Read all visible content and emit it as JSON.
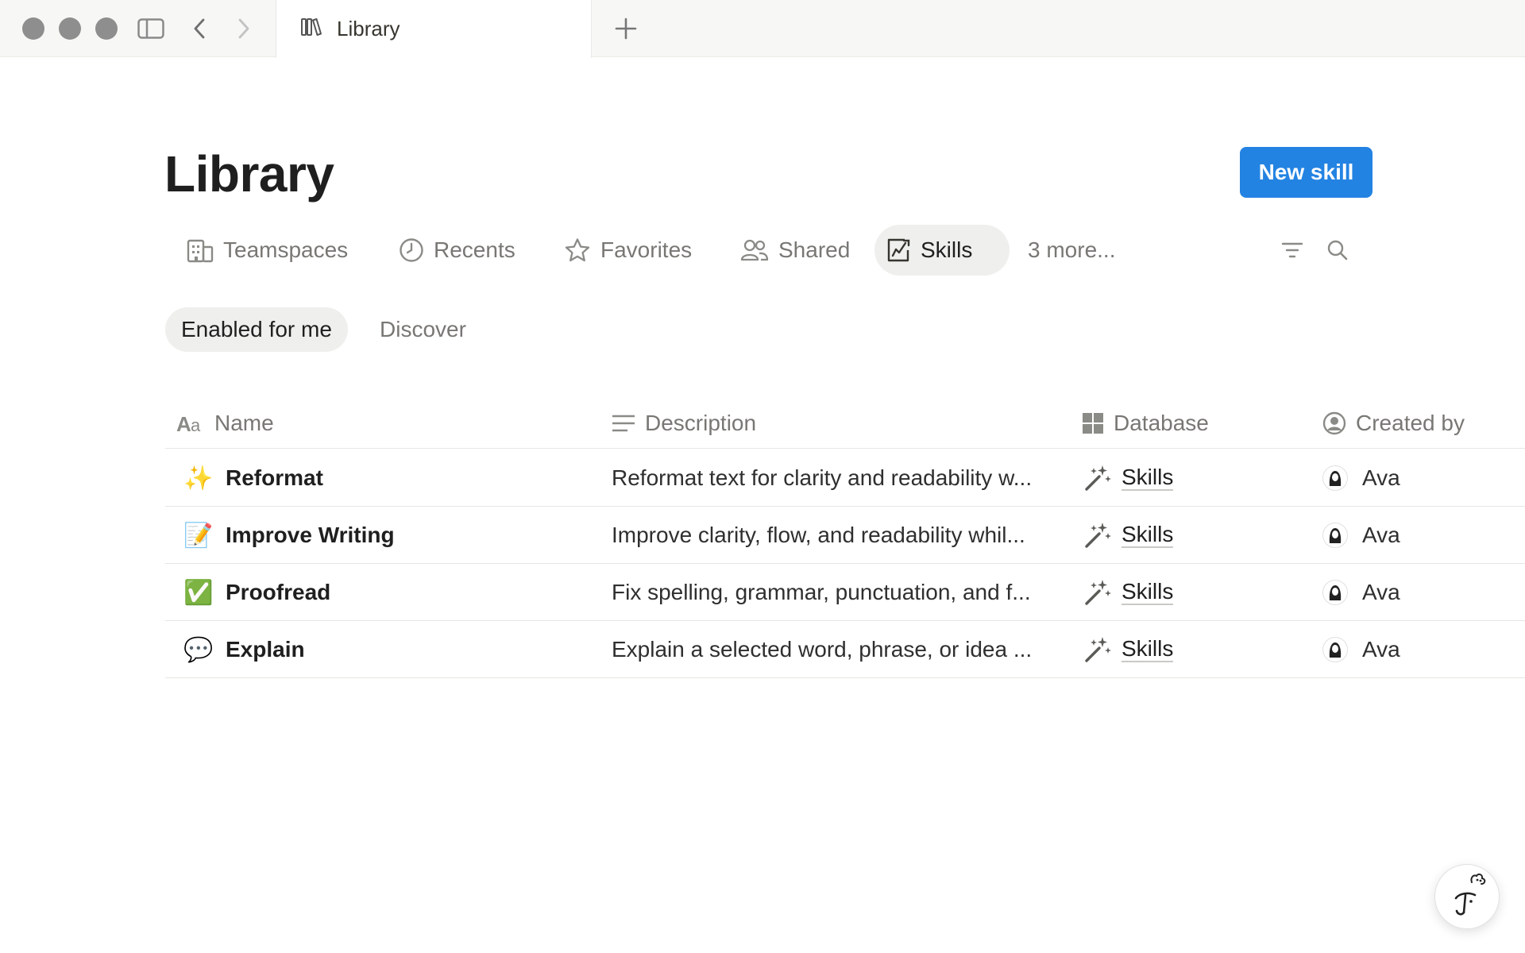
{
  "window": {
    "tab_title": "Library"
  },
  "page": {
    "title": "Library",
    "new_skill_label": "New skill"
  },
  "nav_tabs": [
    {
      "label": "Teamspaces",
      "icon": "building-icon"
    },
    {
      "label": "Recents",
      "icon": "clock-icon"
    },
    {
      "label": "Favorites",
      "icon": "star-icon"
    },
    {
      "label": "Shared",
      "icon": "people-icon"
    },
    {
      "label": "Skills",
      "icon": "skills-icon",
      "active": true
    }
  ],
  "more_tabs_label": "3 more...",
  "sub_tabs": [
    {
      "label": "Enabled for me",
      "active": true
    },
    {
      "label": "Discover"
    }
  ],
  "table": {
    "columns": [
      {
        "label": "Name",
        "icon": "text-aa-icon"
      },
      {
        "label": "Description",
        "icon": "lines-icon"
      },
      {
        "label": "Database",
        "icon": "grid-icon"
      },
      {
        "label": "Created by",
        "icon": "person-circle-icon"
      }
    ],
    "rows": [
      {
        "emoji": "✨",
        "name": "Reformat",
        "description": "Reformat text for clarity and readability w...",
        "database": "Skills",
        "created_by": "Ava"
      },
      {
        "emoji": "📝",
        "name": "Improve Writing",
        "description": "Improve clarity, flow, and readability whil...",
        "database": "Skills",
        "created_by": "Ava"
      },
      {
        "emoji": "✅",
        "name": "Proofread",
        "description": "Fix spelling, grammar, punctuation, and f...",
        "database": "Skills",
        "created_by": "Ava"
      },
      {
        "emoji": "💬",
        "name": "Explain",
        "description": "Explain a selected word, phrase, or idea ...",
        "database": "Skills",
        "created_by": "Ava"
      }
    ]
  },
  "colors": {
    "accent": "#2383e2",
    "active_tab_bg": "#efefed",
    "muted_text": "#787774"
  }
}
